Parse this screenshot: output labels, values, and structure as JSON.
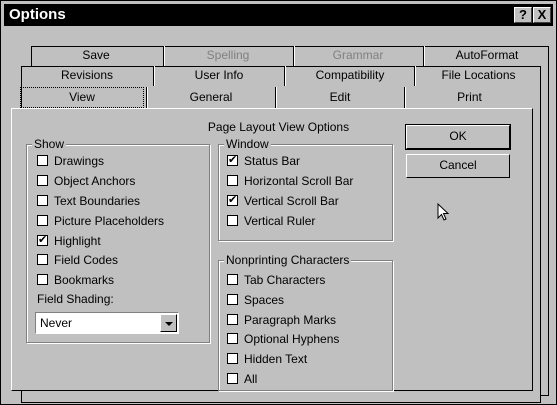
{
  "window": {
    "title": "Options",
    "help_glyph": "?",
    "close_glyph": "X"
  },
  "tabs": {
    "row1": [
      {
        "label": "Save",
        "disabled": false
      },
      {
        "label": "Spelling",
        "disabled": true
      },
      {
        "label": "Grammar",
        "disabled": true
      },
      {
        "label": "AutoFormat",
        "disabled": false
      }
    ],
    "row2": [
      {
        "label": "Revisions"
      },
      {
        "label": "User Info"
      },
      {
        "label": "Compatibility"
      },
      {
        "label": "File Locations"
      }
    ],
    "row3": [
      {
        "label": "View",
        "active": true
      },
      {
        "label": "General"
      },
      {
        "label": "Edit"
      },
      {
        "label": "Print"
      }
    ]
  },
  "page": {
    "title": "Page Layout View Options",
    "show": {
      "label": "Show",
      "items": [
        {
          "label": "Drawings",
          "checked": false
        },
        {
          "label": "Object Anchors",
          "checked": false
        },
        {
          "label": "Text Boundaries",
          "checked": false
        },
        {
          "label": "Picture Placeholders",
          "checked": false
        },
        {
          "label": "Highlight",
          "checked": true
        },
        {
          "label": "Field Codes",
          "checked": false
        },
        {
          "label": "Bookmarks",
          "checked": false
        }
      ],
      "field_shading_label": "Field Shading:",
      "field_shading_value": "Never"
    },
    "window_group": {
      "label": "Window",
      "items": [
        {
          "label": "Status Bar",
          "checked": true
        },
        {
          "label": "Horizontal Scroll Bar",
          "checked": false
        },
        {
          "label": "Vertical Scroll Bar",
          "checked": true
        },
        {
          "label": "Vertical Ruler",
          "checked": false
        }
      ]
    },
    "nonprinting": {
      "label": "Nonprinting Characters",
      "items": [
        {
          "label": "Tab Characters",
          "checked": false
        },
        {
          "label": "Spaces",
          "checked": false
        },
        {
          "label": "Paragraph Marks",
          "checked": false
        },
        {
          "label": "Optional Hyphens",
          "checked": false
        },
        {
          "label": "Hidden Text",
          "checked": false
        },
        {
          "label": "All",
          "checked": false
        }
      ]
    }
  },
  "buttons": {
    "ok": "OK",
    "cancel": "Cancel"
  }
}
